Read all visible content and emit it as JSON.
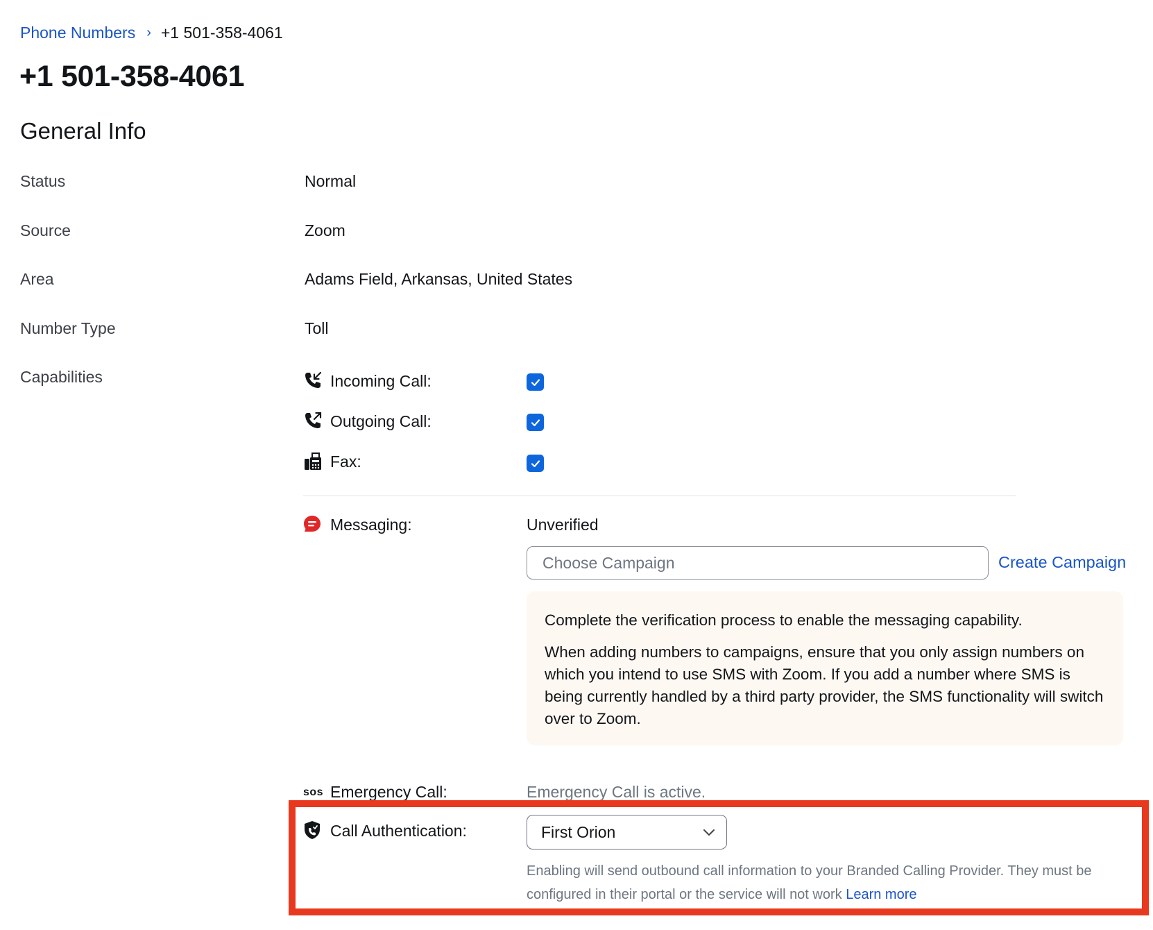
{
  "breadcrumb": {
    "parent": "Phone Numbers",
    "separator": "›",
    "current": "+1 501-358-4061"
  },
  "page_title": "+1 501-358-4061",
  "section_title": "General Info",
  "info": {
    "status_label": "Status",
    "status_value": "Normal",
    "source_label": "Source",
    "source_value": "Zoom",
    "area_label": "Area",
    "area_value": "Adams Field, Arkansas, United States",
    "number_type_label": "Number Type",
    "number_type_value": "Toll",
    "capabilities_label": "Capabilities"
  },
  "capabilities": {
    "incoming_label": "Incoming Call:",
    "incoming_checked": true,
    "outgoing_label": "Outgoing Call:",
    "outgoing_checked": true,
    "fax_label": "Fax:",
    "fax_checked": true
  },
  "messaging": {
    "label": "Messaging:",
    "status": "Unverified",
    "campaign_placeholder": "Choose Campaign",
    "create_link": "Create Campaign",
    "notice_line1": "Complete the verification process to enable the messaging capability.",
    "notice_line2": "When adding numbers to campaigns, ensure that you only assign numbers on which you intend to use SMS with Zoom. If you add a number where SMS is being currently handled by a third party provider, the SMS functionality will switch over to Zoom."
  },
  "emergency": {
    "icon_text": "sos",
    "label": "Emergency Call:",
    "status": "Emergency Call is active."
  },
  "call_auth": {
    "label": "Call Authentication:",
    "selected": "First Orion",
    "description": "Enabling will send outbound call information to your Branded Calling Provider. They must be configured in their portal or the service will not work",
    "learn_more": "Learn more"
  },
  "colors": {
    "link": "#1a54c8",
    "checkbox": "#0e66dd",
    "highlight": "#e8391e",
    "messaging_icon": "#e02828",
    "notice_bg": "#fef8f3"
  },
  "icons": [
    "chevron-right-icon",
    "incoming-call-icon",
    "outgoing-call-icon",
    "fax-icon",
    "message-warning-icon",
    "shield-icon",
    "chevron-down-icon",
    "check-icon"
  ]
}
